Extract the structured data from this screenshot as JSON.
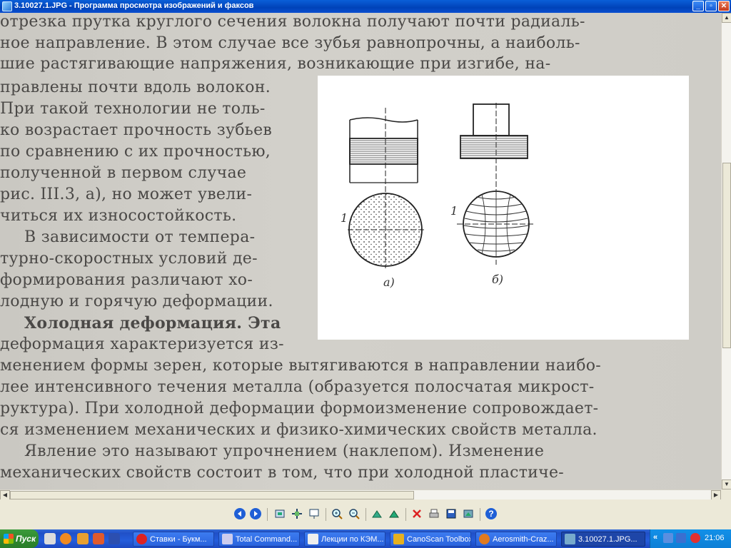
{
  "window": {
    "title": "3.10027.1.JPG - Программа просмотра изображений и факсов",
    "minimize": "_",
    "maximize": "▫",
    "close": "✕"
  },
  "document": {
    "lines_top": [
      "отрезка прутка круглого сечения волокна получают почти радиаль-",
      "ное направление. В этом случае все зубья равнопрочны, а наиболь-",
      "шие растягивающие напряжения, возникающие при изгибе, на-"
    ],
    "lines_left": [
      "правлены почти вдоль волокон.",
      "При такой технологии не толь-",
      "ко возрастает прочность зубьев",
      "по сравнению с их прочностью,",
      "полученной в первом случае",
      "рис. III.3, а), но может увели-",
      "читься их износостойкость.",
      "В зависимости от темпера-",
      "турно-скоростных условий де-",
      "формирования различают хо-",
      "лодную и горячую деформации.",
      "Холодная деформация. Эта",
      "деформация характеризуется из-"
    ],
    "lines_bottom": [
      "менением формы зерен, которые вытягиваются в направлении наибо-",
      "лее интенсивного течения металла (образуется полосчатая микрост-",
      "руктура). При холодной деформации формоизменение сопровождает-",
      "ся изменением механических и физико-химических свойств металла.",
      "Явление это называют упрочнением (наклепом). Изменение",
      "механических свойств состоит в том, что при холодной пластиче-"
    ],
    "figure": {
      "label_a": "а)",
      "label_b": "б)",
      "marker_a": "1",
      "marker_b": "1"
    }
  },
  "toolbar": {
    "buttons": [
      "prev-image",
      "next-image",
      "best-fit",
      "actual-size",
      "slideshow",
      "zoom-in",
      "zoom-out",
      "rotate-clockwise",
      "rotate-counterclockwise",
      "delete",
      "print",
      "save",
      "edit",
      "help"
    ]
  },
  "taskbar": {
    "start_label": "Пуск",
    "tasks": [
      {
        "label": "Ставки - Букм...",
        "icon": "opera-icon"
      },
      {
        "label": "Total Command...",
        "icon": "total-commander-icon"
      },
      {
        "label": "Лекции по КЭМ...",
        "icon": "word-icon"
      },
      {
        "label": "CanoScan Toolbox",
        "icon": "canoscan-icon"
      },
      {
        "label": "Aerosmith-Craz...",
        "icon": "winamp-icon"
      },
      {
        "label": "3.10027.1.JPG...",
        "icon": "image-viewer-icon"
      }
    ],
    "tray_chevron": "«",
    "clock": "21:06"
  }
}
